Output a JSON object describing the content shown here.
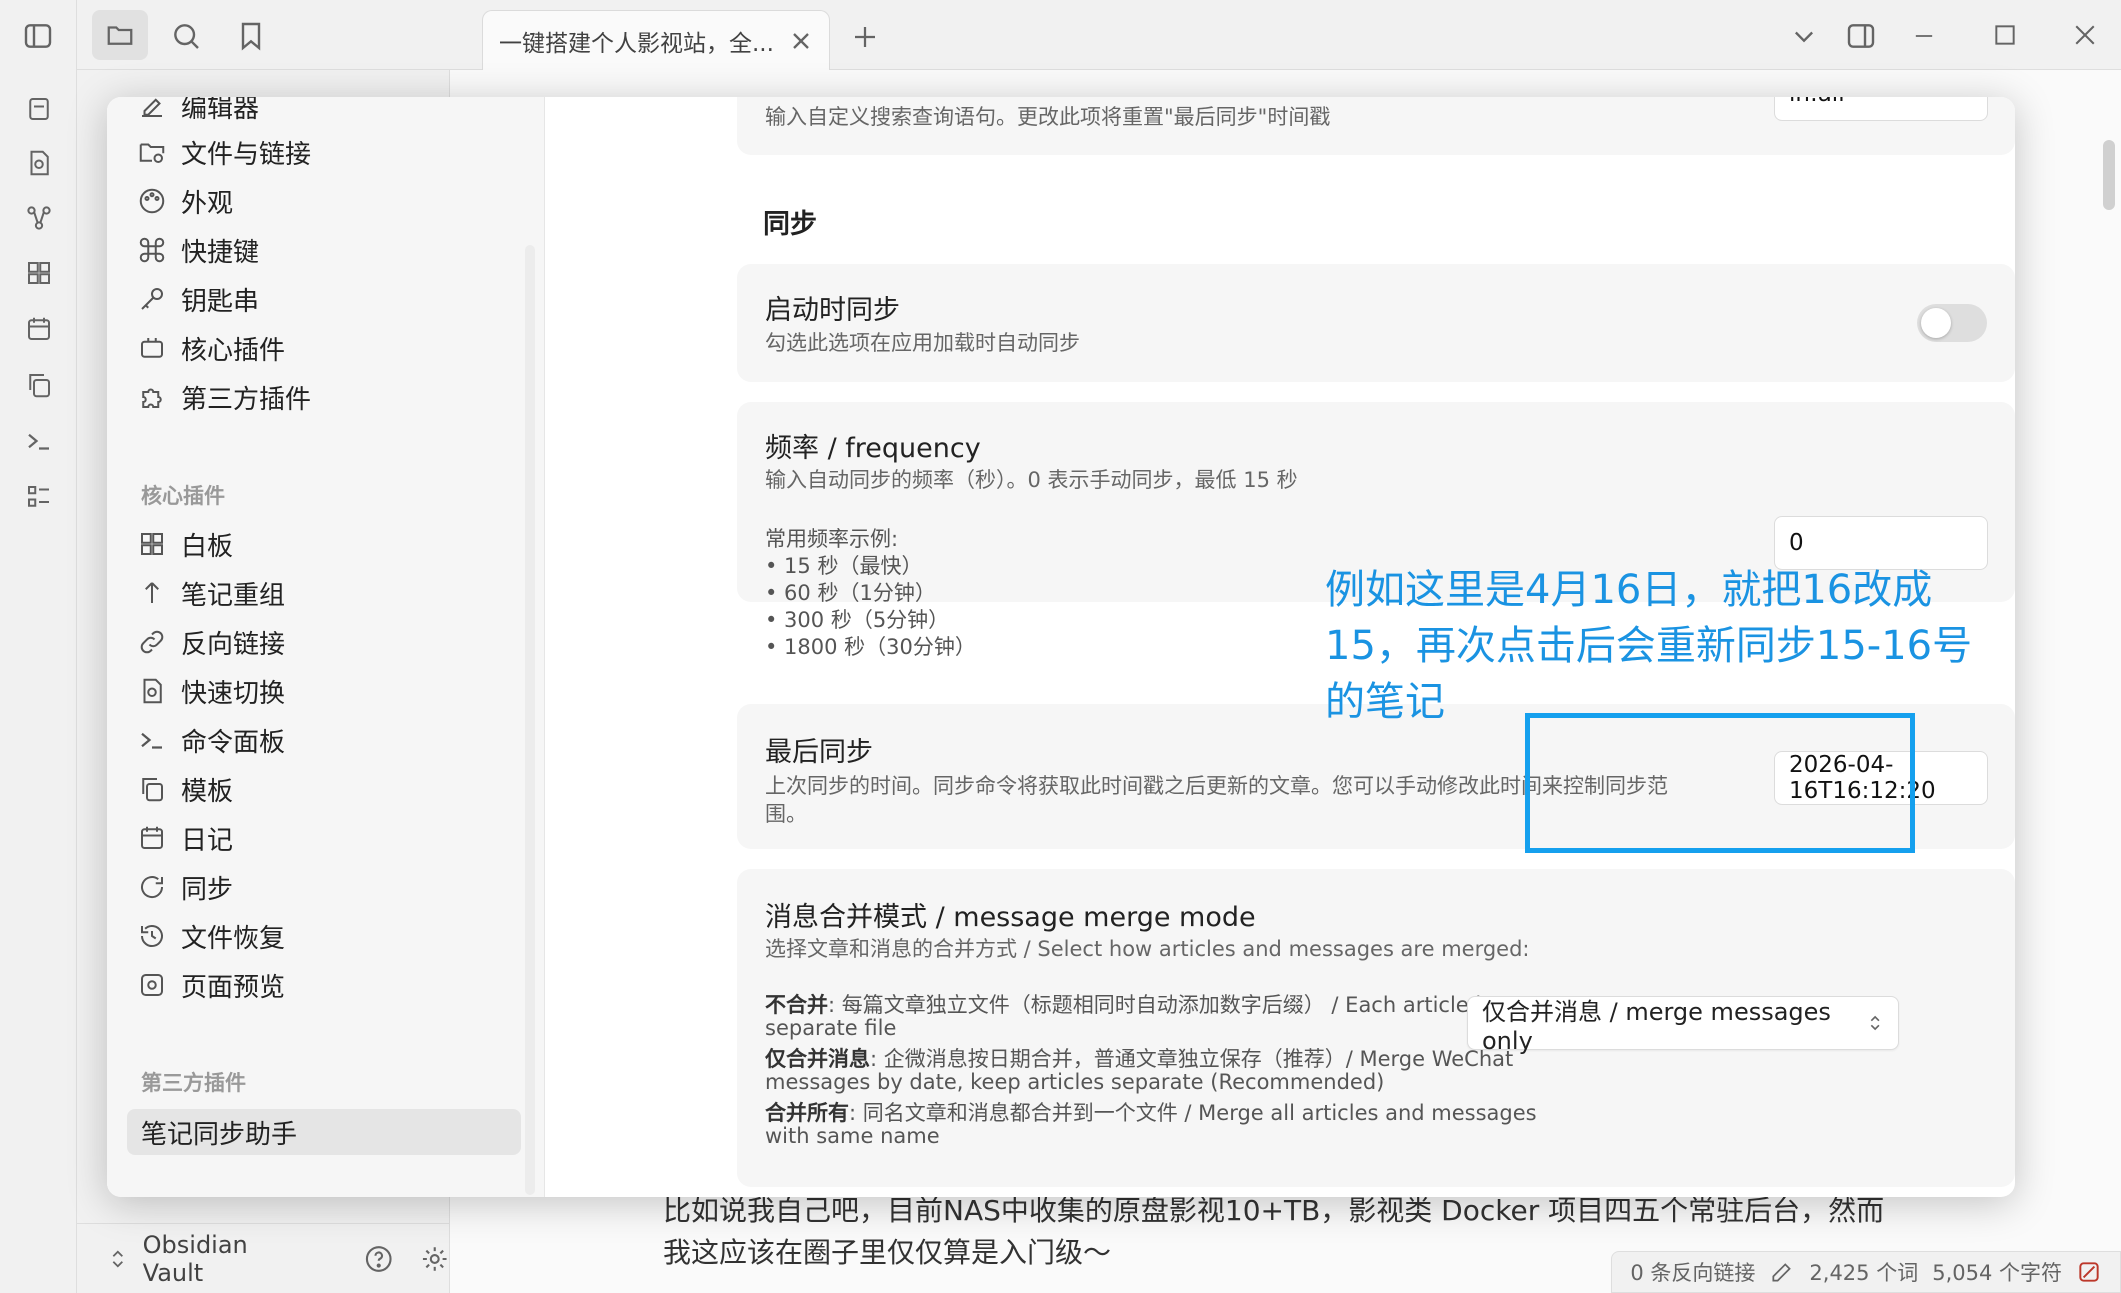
{
  "app": {
    "tab_title": "一键搭建个人影视站，全...",
    "editor_body": "比如说我自己吧，目前NAS中收集的原盘影视10+TB，影视类 Docker 项目四五个常驻后台，然而我这应该在圈子里仅仅算是入门级～",
    "vault_name": "Obsidian Vault",
    "status": {
      "backlinks": "0 条反向链接",
      "words": "2,425 个词",
      "chars": "5,054 个字符"
    }
  },
  "settings_nav": {
    "options_items": [
      "编辑器",
      "文件与链接",
      "外观",
      "快捷键",
      "钥匙串",
      "核心插件",
      "第三方插件"
    ],
    "core_section_label": "核心插件",
    "core_items": [
      "白板",
      "笔记重组",
      "反向链接",
      "快速切换",
      "命令面板",
      "模板",
      "日记",
      "同步",
      "文件恢复",
      "页面预览"
    ],
    "community_section_label": "第三方插件",
    "community_items": [
      "笔记同步助手"
    ]
  },
  "settings": {
    "top_desc": "输入自定义搜索查询语句。更改此项将重置\"最后同步\"时间戳",
    "top_input_value": "in:all",
    "sync_section_title": "同步",
    "sync_on_start": {
      "name": "启动时同步",
      "desc": "勾选此选项在应用加载时自动同步",
      "enabled": false
    },
    "frequency": {
      "name": "频率 / frequency",
      "desc": "输入自动同步的频率（秒）。0 表示手动同步，最低 15 秒",
      "examples_title": "常用频率示例:",
      "examples": [
        "• 15 秒（最快）",
        "• 60 秒（1分钟）",
        "• 300 秒（5分钟）",
        "• 1800 秒（30分钟）"
      ],
      "value": "0"
    },
    "last_sync": {
      "name": "最后同步",
      "desc": "上次同步的时间。同步命令将获取此时间戳之后更新的文章。您可以手动修改此时间来控制同步范围。",
      "value": "2026-04-16T16:12:20"
    },
    "merge_mode": {
      "name": "消息合并模式 / message merge mode",
      "desc": "选择文章和消息的合并方式 / Select how articles and messages are merged:",
      "opt1_label": "不合并",
      "opt1_text": ": 每篇文章独立文件（标题相同时自动添加数字后缀） / Each article in",
      "opt1_text2": "separate file",
      "opt2_label": "仅合并消息",
      "opt2_text": ": 企微消息按日期合并，普通文章独立保存（推荐）/ Merge WeChat",
      "opt2_text2": "messages by date, keep articles separate (Recommended)",
      "opt3_label": "合并所有",
      "opt3_text": ": 同名文章和消息都合并到一个文件 / Merge all articles and messages",
      "opt3_text2": "with same name",
      "selected": "仅合并消息 / merge messages only"
    }
  },
  "annotation": {
    "text": "例如这里是4月16日，就把16改成15，再次点击后会重新同步15-16号的笔记",
    "color": "#1a93e2"
  }
}
